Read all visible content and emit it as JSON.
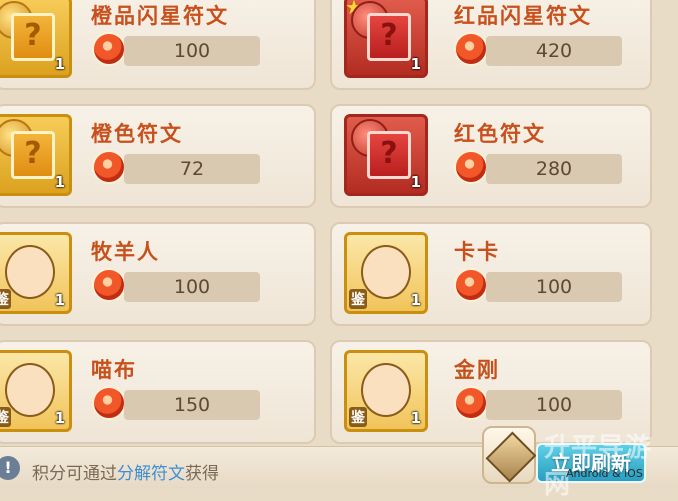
{
  "items": [
    {
      "name": "橙品闪星符文",
      "price": "100",
      "count": "1",
      "type": "gold",
      "star": false
    },
    {
      "name": "红品闪星符文",
      "price": "420",
      "count": "1",
      "type": "red",
      "star": true
    },
    {
      "name": "橙色符文",
      "price": "72",
      "count": "1",
      "type": "gold",
      "star": false
    },
    {
      "name": "红色符文",
      "price": "280",
      "count": "1",
      "type": "red",
      "star": false
    },
    {
      "name": "牧羊人",
      "price": "100",
      "count": "1",
      "type": "portrait",
      "badge": "鉴"
    },
    {
      "name": "卡卡",
      "price": "100",
      "count": "1",
      "type": "portrait",
      "badge": "鉴"
    },
    {
      "name": "喵布",
      "price": "150",
      "count": "1",
      "type": "portrait",
      "badge": "鉴"
    },
    {
      "name": "金刚",
      "price": "100",
      "count": "1",
      "type": "portrait",
      "badge": "鉴"
    }
  ],
  "footer": {
    "hint_prefix": "积分可通过",
    "hint_link": "分解符文",
    "hint_suffix": "获得",
    "refresh_label": "立即刷新",
    "info_glyph": "!"
  },
  "watermark": {
    "main": "升平导游网",
    "sub": "Android & iOS"
  }
}
